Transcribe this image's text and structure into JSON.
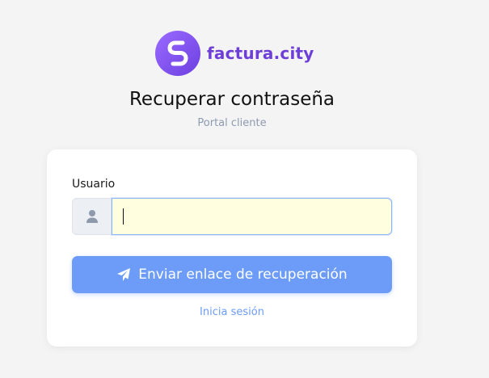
{
  "brand": {
    "name": "factura.city",
    "logo_icon": "factura-city-logo-icon",
    "colors": {
      "logo_start": "#9b6bff",
      "logo_end": "#6c3fe0",
      "name": "#6d3fd8"
    }
  },
  "header": {
    "title": "Recuperar contraseña",
    "subtitle": "Portal cliente"
  },
  "form": {
    "username_label": "Usuario",
    "username_icon": "user-icon",
    "username_value": "",
    "username_placeholder": "",
    "submit_label": "Enviar enlace de recuperación",
    "submit_icon": "send-icon",
    "login_link_label": "Inicia sesión"
  },
  "colors": {
    "accent": "#6c9cf8",
    "background": "#f4f4f5",
    "input_autofill": "#ffffe0"
  }
}
